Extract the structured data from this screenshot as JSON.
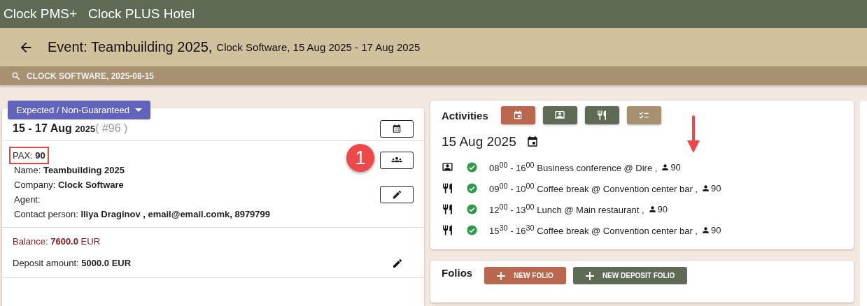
{
  "app_bar": {
    "product": "Clock PMS+",
    "hotel": "Clock PLUS Hotel"
  },
  "header": {
    "title": "Event: Teambuilding 2025,",
    "subtitle": "Clock Software, 15 Aug 2025 - 17 Aug 2025"
  },
  "search": {
    "value": "CLOCK SOFTWARE, 2025-08-15"
  },
  "event": {
    "status": "Expected / Non-Guaranteed",
    "dates": "15 - 17 Aug",
    "year": "2025",
    "number": "( #96 )",
    "fields": [
      {
        "label": "PAX:",
        "value": "90",
        "highlighted": true
      },
      {
        "label": "Name:",
        "value": "Teambuilding 2025",
        "highlighted": false
      },
      {
        "label": "Company:",
        "value": "Clock Software",
        "highlighted": false
      },
      {
        "label": "Agent:",
        "highlighted": false
      },
      {
        "label": "Contact person:",
        "value": "Iliya Draginov , email@email.comk, 8979799",
        "highlighted": false
      }
    ],
    "callout": "1",
    "balance": {
      "label": "Balance:",
      "value": "7600.0",
      "currency": "EUR"
    },
    "deposit": {
      "label": "Deposit amount:",
      "value": "5000.0 EUR"
    }
  },
  "activities": {
    "title": "Activities",
    "filters": [
      {
        "kind": "calendar",
        "color": "#b9684f"
      },
      {
        "kind": "conference",
        "color": "#5f6b55"
      },
      {
        "kind": "food",
        "color": "#5f6b55"
      },
      {
        "kind": "checklist",
        "color": "#a69170"
      }
    ],
    "date": "15 Aug 2025",
    "items": [
      {
        "kind": "conference",
        "confirmed": true,
        "text": "08$^{00}$ - 16$^{00}$ Business conference @ Dire ,",
        "pax": "90"
      },
      {
        "kind": "food",
        "confirmed": true,
        "text": "09$^{00}$ - 10$^{00}$ Coffee break @ Convention center bar ,",
        "pax": "90"
      },
      {
        "kind": "food",
        "confirmed": true,
        "text": "12$^{00}$ - 13$^{00}$ Lunch @ Main restaurant ,",
        "pax": "90"
      },
      {
        "kind": "food",
        "confirmed": true,
        "text": "15$^{30}$ - 16$^{30}$ Coffee break @ Convention center bar ,",
        "pax": "90"
      }
    ]
  },
  "folios": {
    "title": "Folios",
    "buttons": [
      {
        "label": "NEW FOLIO",
        "color": "#b9684f"
      },
      {
        "label": "NEW DEPOSIT FOLIO",
        "color": "#5f6b55"
      }
    ]
  }
}
